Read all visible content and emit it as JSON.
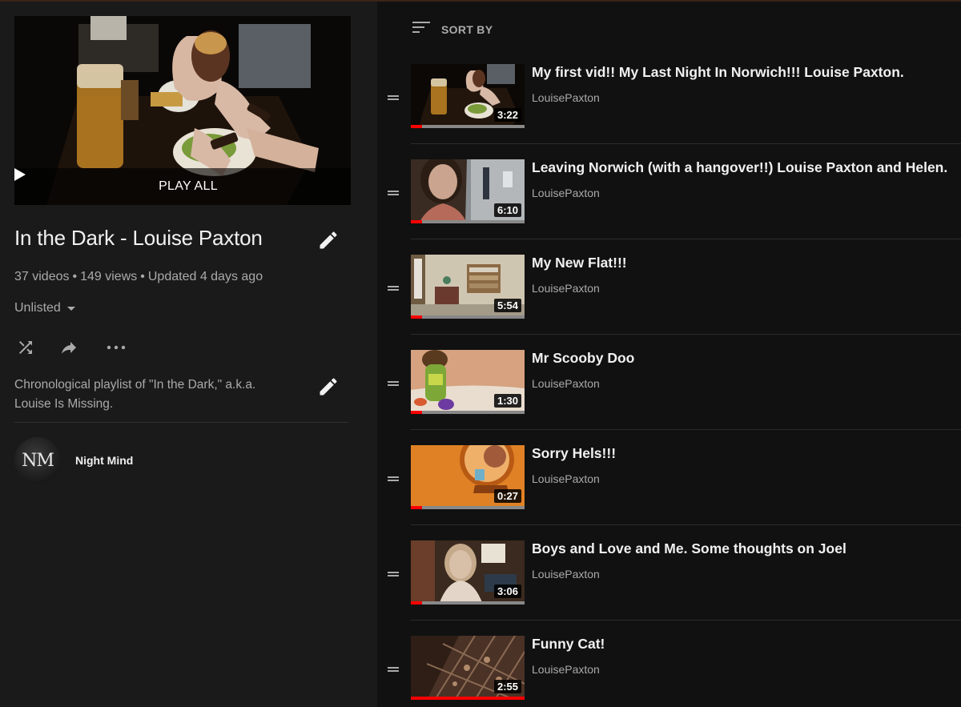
{
  "playlist": {
    "play_all_label": "PLAY ALL",
    "title": "In the Dark - Louise Paxton",
    "video_count": "37 videos",
    "view_count": "149 views",
    "updated": "Updated 4 days ago",
    "privacy": "Unlisted",
    "description_line1": "Chronological playlist of \"In the Dark,\" a.k.a.",
    "description_line2": "Louise Is Missing.",
    "owner": {
      "name": "Night Mind",
      "avatar_text": "NM"
    }
  },
  "sort_label": "SORT BY",
  "videos": [
    {
      "title": "My first vid!! My Last Night In Norwich!!! Louise Paxton.",
      "channel": "LouisePaxton",
      "duration": "3:22",
      "progress": 0.1
    },
    {
      "title": "Leaving Norwich (with a hangover!!) Louise Paxton and Helen.",
      "channel": "LouisePaxton",
      "duration": "6:10",
      "progress": 0.1
    },
    {
      "title": "My New Flat!!!",
      "channel": "LouisePaxton",
      "duration": "5:54",
      "progress": 0.1
    },
    {
      "title": "Mr Scooby Doo",
      "channel": "LouisePaxton",
      "duration": "1:30",
      "progress": 0.1
    },
    {
      "title": "Sorry Hels!!!",
      "channel": "LouisePaxton",
      "duration": "0:27",
      "progress": 0.1
    },
    {
      "title": "Boys and Love and Me. Some thoughts on Joel",
      "channel": "LouisePaxton",
      "duration": "3:06",
      "progress": 0.1
    },
    {
      "title": "Funny Cat!",
      "channel": "LouisePaxton",
      "duration": "2:55",
      "progress": 1.0
    }
  ],
  "colors": {
    "accent": "#ff0000",
    "background": "#0f0f0f",
    "panel": "#1a1a1a",
    "secondary_text": "#aaaaaa"
  }
}
